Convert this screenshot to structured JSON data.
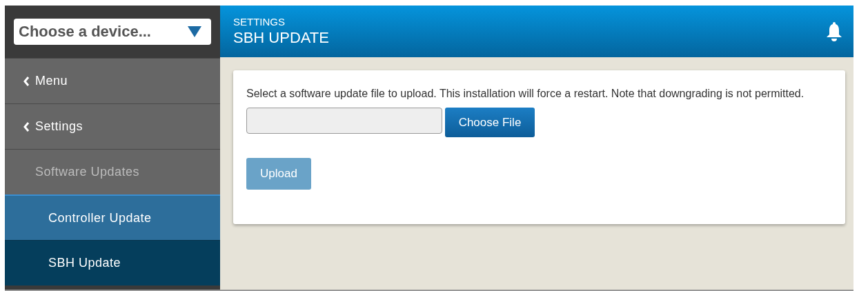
{
  "device_select": {
    "placeholder": "Choose a device..."
  },
  "header": {
    "section": "SETTINGS",
    "title": "SBH UPDATE"
  },
  "sidebar": {
    "items": [
      {
        "kind": "back",
        "label": "Menu"
      },
      {
        "kind": "back",
        "label": "Settings"
      },
      {
        "kind": "section",
        "label": "Software Updates"
      },
      {
        "kind": "subitem",
        "label": "Controller Update",
        "selected": false
      },
      {
        "kind": "subitem",
        "label": "SBH Update",
        "selected": true
      }
    ]
  },
  "card": {
    "instructions": "Select a software update file to upload. This installation will force a restart. Note that downgrading is not permitted.",
    "file_button": "Choose File",
    "upload_button": {
      "label": "Upload",
      "disabled": true
    }
  }
}
